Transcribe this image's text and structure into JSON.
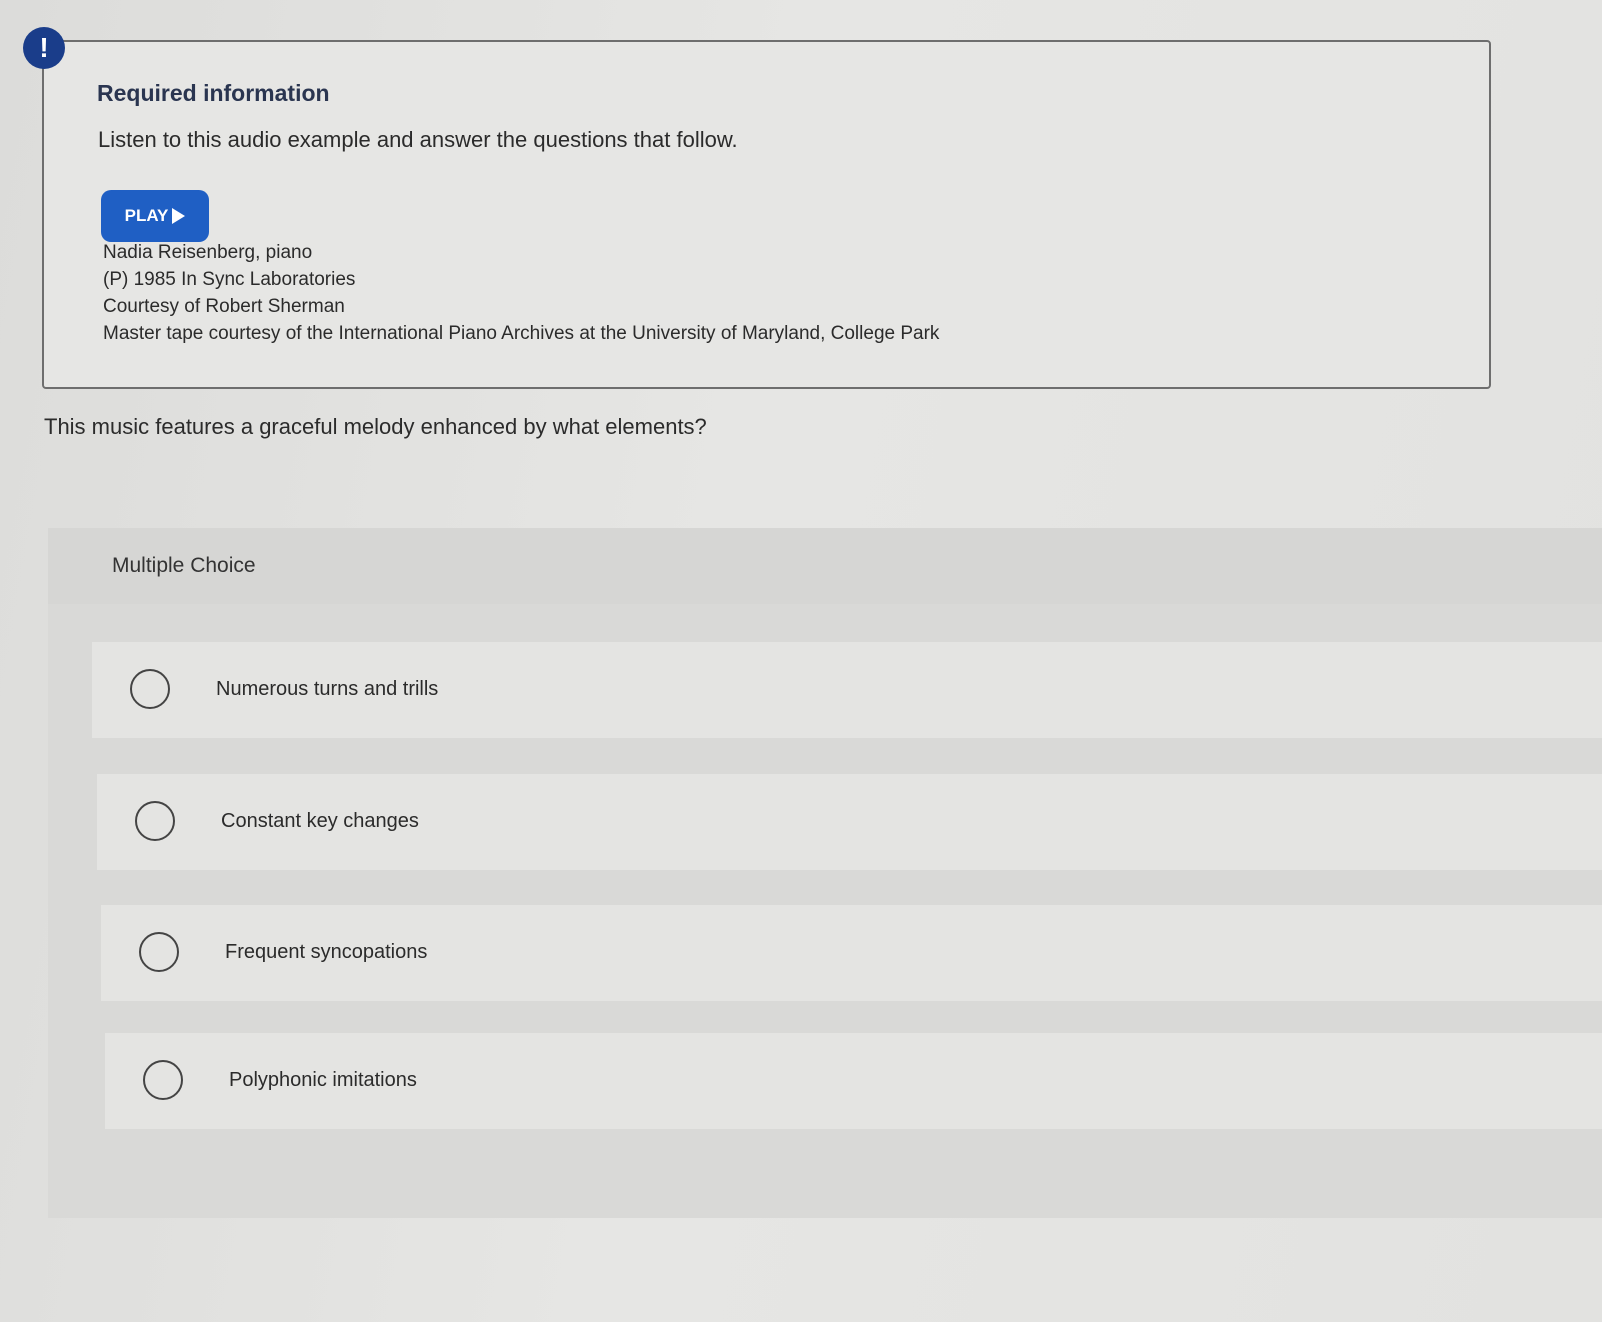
{
  "alert": {
    "icon": "exclamation-icon",
    "glyph": "!",
    "color": "#1a3d8a"
  },
  "info": {
    "title": "Required information",
    "instruction": "Listen to this audio example and answer the questions that follow.",
    "play_label": "PLAY",
    "play_color": "#1f5fc4",
    "credits": [
      "Nadia Reisenberg, piano",
      "(P) 1985 In Sync Laboratories",
      "Courtesy of Robert Sherman",
      "Master tape courtesy of the International Piano Archives at the University of Maryland, College Park"
    ]
  },
  "question": {
    "text": "This music features a graceful melody enhanced by what elements?"
  },
  "multiple_choice": {
    "label": "Multiple Choice",
    "options": [
      "Numerous turns and trills",
      "Constant key changes",
      "Frequent syncopations",
      "Polyphonic imitations"
    ]
  }
}
